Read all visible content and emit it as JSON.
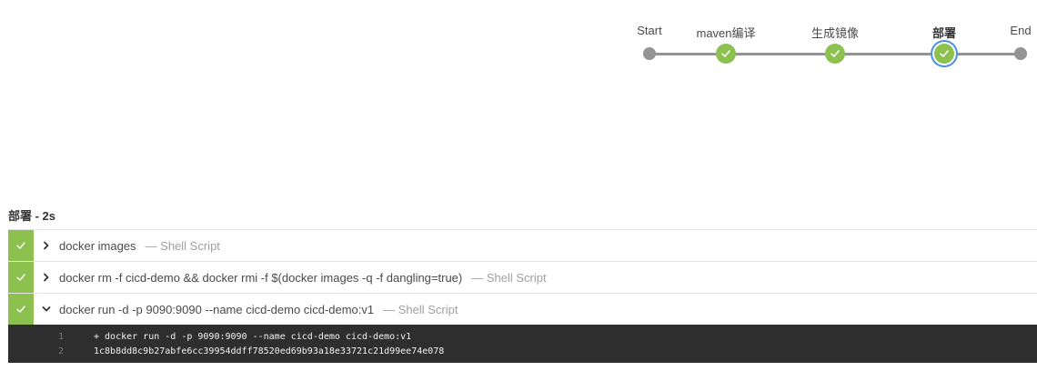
{
  "pipeline": {
    "stages": [
      {
        "label": "Start",
        "status": "start"
      },
      {
        "label": "maven编译",
        "status": "success"
      },
      {
        "label": "生成镜像",
        "status": "success"
      },
      {
        "label": "部署",
        "status": "success",
        "selected": true
      },
      {
        "label": "End",
        "status": "end"
      }
    ]
  },
  "detail": {
    "title": "部署 - 2s",
    "steps": [
      {
        "command": "docker images",
        "type": "— Shell Script",
        "status": "success",
        "expanded": false
      },
      {
        "command": "docker rm -f cicd-demo && docker rmi -f $(docker images -q -f dangling=true)",
        "type": "— Shell Script",
        "status": "success",
        "expanded": false
      },
      {
        "command": "docker run -d -p 9090:9090 --name cicd-demo cicd-demo:v1",
        "type": "— Shell Script",
        "status": "success",
        "expanded": true
      }
    ],
    "log": [
      {
        "num": "1",
        "text": "+ docker run -d -p 9090:9090 --name cicd-demo cicd-demo:v1"
      },
      {
        "num": "2",
        "text": "1c8b8dd8c9b27abfe6cc39954ddff78520ed69b93a18e33721c21d99ee74e078"
      }
    ]
  },
  "colors": {
    "success": "#8cc04f",
    "selected_ring": "#4a90e2",
    "line": "#949494",
    "log_bg": "#2e2e2e"
  }
}
